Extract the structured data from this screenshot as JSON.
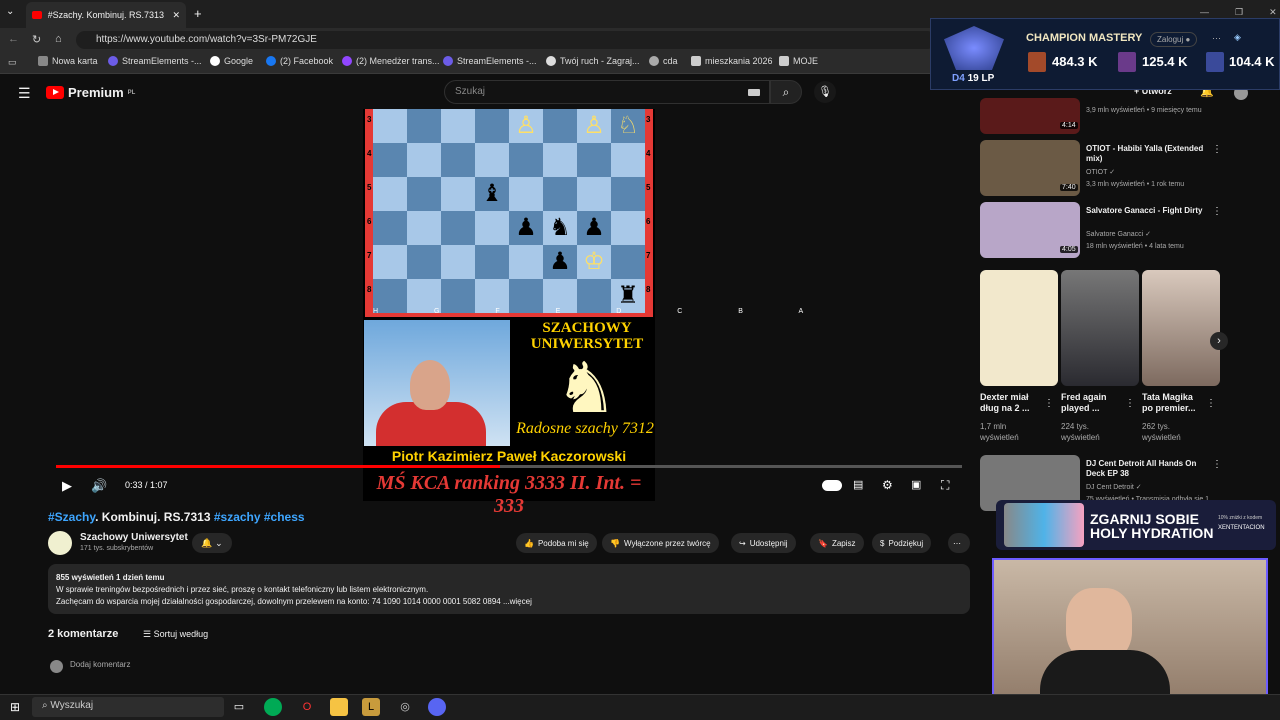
{
  "browser": {
    "tab_title": "#Szachy. Kombinuj. RS.7313 #szac",
    "url": "https://www.youtube.com/watch?v=3Sr-PM72GJE",
    "bookmarks": [
      "Nowa karta",
      "StreamElements -...",
      "Google",
      "(2) Facebook",
      "(2) Menedżer trans...",
      "StreamElements -...",
      "Twój ruch - Zagraj...",
      "cda",
      "mieszkania 2026",
      "MOJE"
    ]
  },
  "youtube": {
    "logo": "Premium",
    "logo_region": "PL",
    "search_placeholder": "Szukaj",
    "create_label": "Utwórz"
  },
  "video": {
    "board_ranks": [
      "3",
      "4",
      "5",
      "6",
      "7",
      "8"
    ],
    "board_files": "H G F E D C B A",
    "channel_banner_title": "SZACHOWY UNIWERSYTET",
    "series_label": "Radosne szachy 7312",
    "author_line": "Piotr Kazimierz Paweł Kaczorowski",
    "ranking_line": "MŚ KCA ranking 3333   II. Int. = 333",
    "time": "0:33 / 1:07",
    "progress": 0.49
  },
  "info": {
    "title_tag1": "#Szachy",
    "title_main": ". Kombinuj. RS.7313 ",
    "title_tags2": "#szachy #chess",
    "channel": "Szachowy Uniwersytet",
    "subscribers": "171 tys. subskrybentów",
    "actions": [
      "Podoba mi się",
      "Wyłączone przez twórcę",
      "Udostępnij",
      "Zapisz",
      "Podziękuj"
    ],
    "views": "855 wyświetleń  1 dzień temu",
    "desc_line1": "W sprawie treningów bezpośrednich i przez sieć, proszę o kontakt telefoniczny lub listem elektronicznym.",
    "desc_line2": "Zachęcam do wsparcia mojej działalności gospodarczej, dowolnym przelewem na konto: 74 1090 1014 0000 0001 5082 0894 ...więcej",
    "comments_count": "2 komentarze",
    "sort_label": "Sortuj według",
    "add_comment": "Dodaj komentarz"
  },
  "sidebar": {
    "recs": [
      {
        "title": "",
        "meta": "3,9 mln wyświetleń • 9 miesięcy temu",
        "duration": "4:14",
        "color": "#5a1a1a"
      },
      {
        "title": "OTIOT - Habibi Yalla (Extended mix)",
        "channel": "OTIOT",
        "meta": "3,3 mln wyświetleń • 1 rok temu",
        "duration": "7:40",
        "color": "#6b5a45"
      },
      {
        "title": "Salvatore Ganacci - Fight Dirty",
        "channel": "Salvatore Ganacci",
        "meta": "18 mln wyświetleń • 4 lata temu",
        "duration": "4:05",
        "color": "#b8a6c8"
      },
      {
        "title": "DJ Cent Detroit All Hands On Deck EP 38",
        "channel": "DJ Cent Detroit",
        "meta": "75 wyświetleń • Transmisja odbyła się 1",
        "duration": "",
        "color": "#777"
      }
    ],
    "shorts": [
      {
        "title": "Dexter miał dług na 2 ...",
        "meta": "1,7 mln wyświetleń",
        "color": "#e8e0c8"
      },
      {
        "title": "Fred again played ...",
        "meta": "224 tys. wyświetleń",
        "color": "#4a4a52"
      },
      {
        "title": "Tata Magika po premier...",
        "meta": "262 tys. wyświetleń",
        "color": "#a08878"
      }
    ]
  },
  "overlay": {
    "mastery_title": "CHAMPION MASTERY",
    "rank": "D4",
    "lp": "19 LP",
    "stats": [
      "484.3 K",
      "125.4 K",
      "104.4 K"
    ],
    "login": "Zaloguj",
    "ad_title": "ZGARNIJ SOBIE HOLY HYDRATION",
    "ad_brand": "XENTENTACION",
    "ad_sub": "10% zniżki z kodem"
  },
  "taskbar": {
    "search": "Wyszukaj"
  }
}
